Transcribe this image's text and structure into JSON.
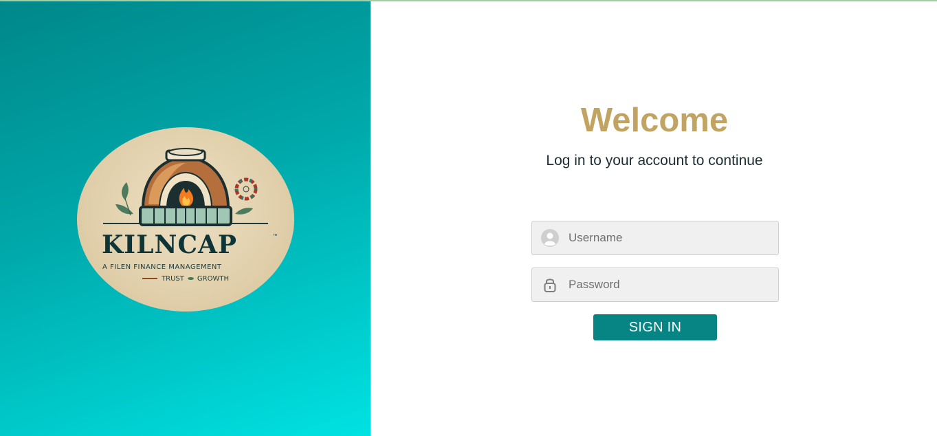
{
  "brand": {
    "name": "KILNCAP",
    "trademark": "™",
    "tagline": "A FILEN FINANCE MANAGEMENT",
    "motto_left": "TRUST",
    "motto_right": "GROWTH"
  },
  "login": {
    "title": "Welcome",
    "subtitle": "Log in to your account to continue",
    "username_placeholder": "Username",
    "username_icon": "user-avatar-icon",
    "password_placeholder": "Password",
    "password_icon": "lock-icon",
    "signin_label": "SIGN IN"
  },
  "colors": {
    "panel_gradient_start": "#00878a",
    "panel_gradient_end": "#00e2e2",
    "title": "#c1a461",
    "button": "#078484"
  }
}
